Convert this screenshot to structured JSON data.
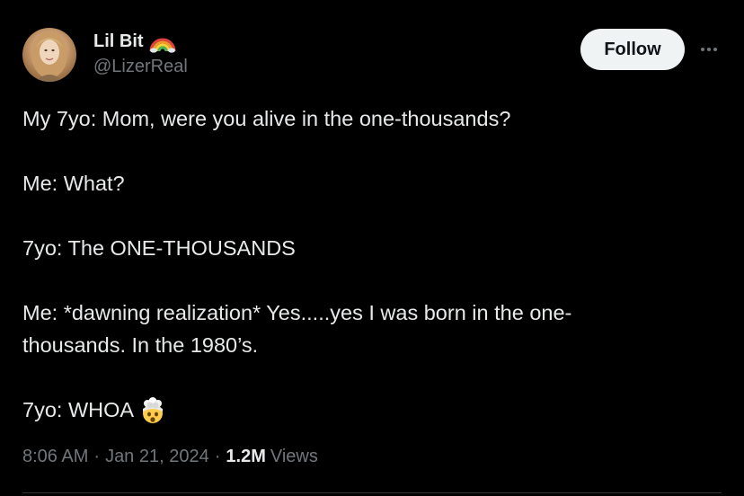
{
  "author": {
    "display_name": "Lil Bit",
    "handle": "@LizerReal",
    "name_badge_icon": "rainbow-icon"
  },
  "actions": {
    "follow_label": "Follow",
    "more_icon": "more-icon"
  },
  "tweet": {
    "lines": [
      "My 7yo: Mom, were you alive in the one-thousands?",
      "Me: What?",
      "7yo: The ONE-THOUSANDS",
      "Me: *dawning realization* Yes.....yes I was born in the one-",
      "thousands. In the 1980’s.",
      "7yo: WHOA"
    ],
    "final_emoji": "exploding-head-emoji"
  },
  "meta": {
    "time": "8:06 AM",
    "date": "Jan 21, 2024",
    "separator": "·",
    "views_count": "1.2M",
    "views_label": "Views"
  },
  "colors": {
    "background": "#000000",
    "text_primary": "#e7e9ea",
    "text_secondary": "#71767b",
    "follow_bg": "#eff3f4",
    "follow_text": "#0f1419"
  }
}
